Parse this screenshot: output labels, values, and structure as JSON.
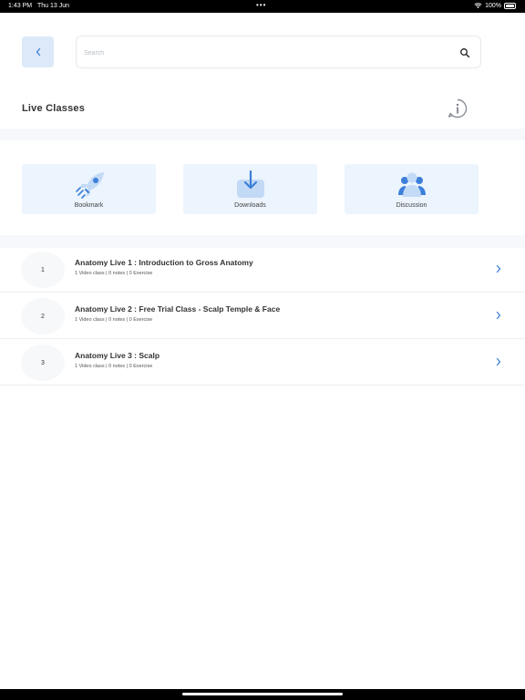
{
  "status_bar": {
    "time": "1:43 PM",
    "date": "Thu 13 Jun",
    "dots": "•••",
    "battery": "100%",
    "icons": [
      "wifi-icon",
      "battery-icon"
    ]
  },
  "header": {
    "back_icon": "chevron-left-icon",
    "search_placeholder": "Search",
    "search_value": "",
    "search_icon": "search-icon"
  },
  "page": {
    "title": "Live Classes",
    "info_icon": "info-icon"
  },
  "quick_links": [
    {
      "label": "Bookmark",
      "icon": "rocket-icon"
    },
    {
      "label": "Downloads",
      "icon": "download-icon"
    },
    {
      "label": "Discussion",
      "icon": "people-icon"
    }
  ],
  "classes": [
    {
      "number": "1",
      "title": "Anatomy Live 1 : Introduction to Gross Anatomy",
      "meta": "1 Video class | 0 notes | 0 Exercise"
    },
    {
      "number": "2",
      "title": "Anatomy Live 2 : Free Trial Class - Scalp Temple & Face",
      "meta": "1 Video class | 0 notes | 0 Exercise"
    },
    {
      "number": "3",
      "title": "Anatomy Live 3 : Scalp",
      "meta": "1 Video class | 0 notes | 0 Exercise"
    }
  ],
  "colors": {
    "accent": "#3b7fd9",
    "card_bg": "#ecf4fd",
    "icon_light": "#c3daf6"
  }
}
